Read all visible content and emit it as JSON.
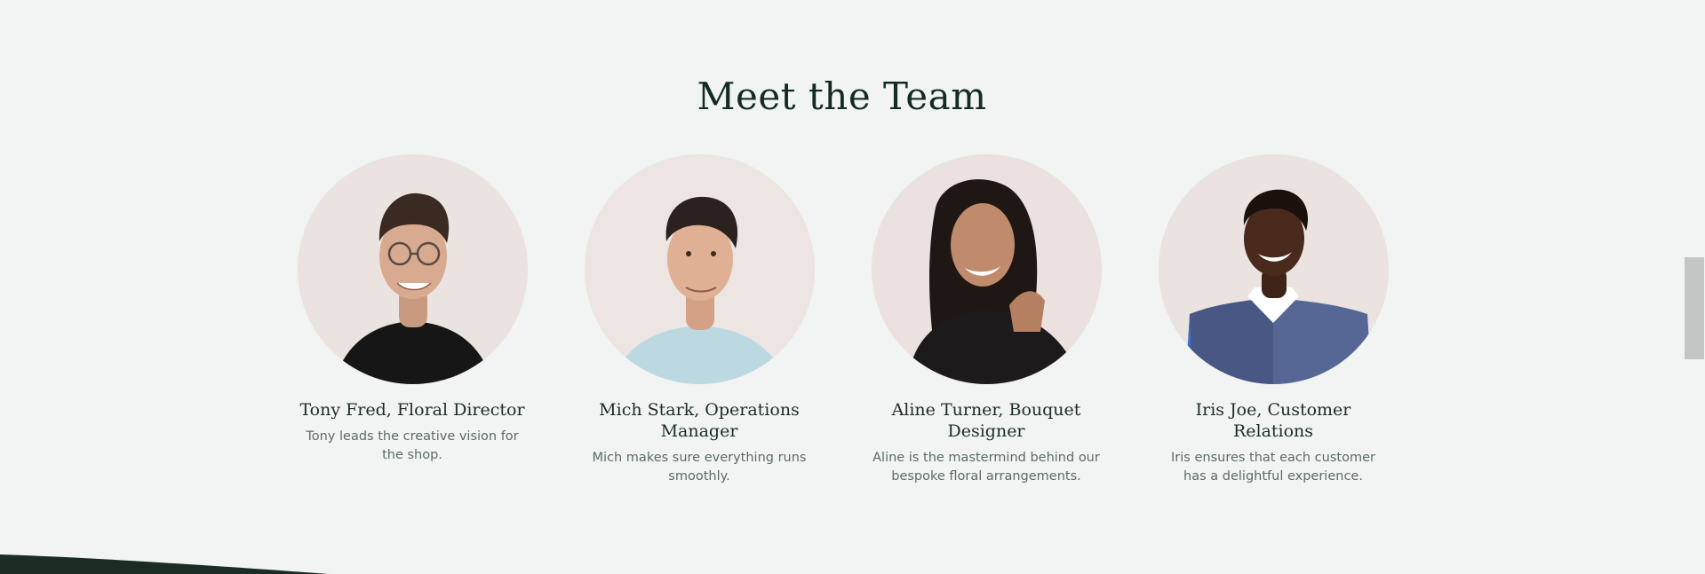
{
  "section": {
    "title": "Meet the Team"
  },
  "team": [
    {
      "name": "Tony Fred, Floral Director",
      "bio": "Tony leads the creative vision for the shop.",
      "avatar_icon": "portrait-photo"
    },
    {
      "name": "Mich Stark, Operations Manager",
      "bio": "Mich makes sure everything runs smoothly.",
      "avatar_icon": "portrait-photo"
    },
    {
      "name": "Aline Turner, Bouquet Designer",
      "bio": "Aline is the mastermind behind our bespoke floral arrangements.",
      "avatar_icon": "portrait-photo"
    },
    {
      "name": "Iris Joe, Customer Relations",
      "bio": "Iris ensures that each customer has a delightful experience.",
      "avatar_icon": "portrait-photo"
    }
  ],
  "colors": {
    "background": "#f1f4f2",
    "heading": "#142b23",
    "body_text": "#5e6a66",
    "footer": "#1b2c24",
    "avatar_bg": "#e8e2df"
  }
}
